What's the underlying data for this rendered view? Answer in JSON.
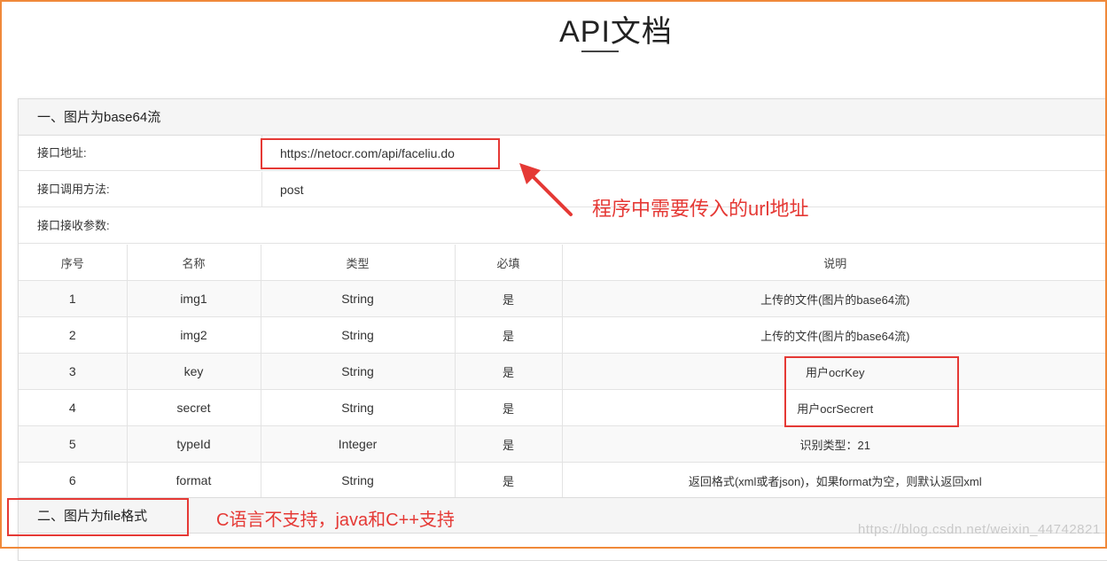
{
  "page": {
    "title": "API文档"
  },
  "section1": {
    "heading": "一、图片为base64流",
    "rows": [
      {
        "label": "接口地址:",
        "value": "https://netocr.com/api/faceliu.do"
      },
      {
        "label": "接口调用方法:",
        "value": "post"
      },
      {
        "label": "接口接收参数:",
        "value": ""
      }
    ],
    "table": {
      "headers": [
        "序号",
        "名称",
        "类型",
        "必填",
        "说明"
      ],
      "rows": [
        [
          "1",
          "img1",
          "String",
          "是",
          "上传的文件(图片的base64流)"
        ],
        [
          "2",
          "img2",
          "String",
          "是",
          "上传的文件(图片的base64流)"
        ],
        [
          "3",
          "key",
          "String",
          "是",
          "用户ocrKey"
        ],
        [
          "4",
          "secret",
          "String",
          "是",
          "用户ocrSecrert"
        ],
        [
          "5",
          "typeId",
          "Integer",
          "是",
          "识别类型：21"
        ],
        [
          "6",
          "format",
          "String",
          "是",
          "返回格式(xml或者json)，如果format为空，则默认返回xml"
        ]
      ]
    }
  },
  "section2": {
    "heading": "二、图片为file格式"
  },
  "annotations": {
    "url_note": "程序中需要传入的url地址",
    "lang_note": "C语言不支持，java和C++支持"
  },
  "watermark": "https://blog.csdn.net/weixin_44742821",
  "colors": {
    "frame": "#f0893a",
    "annotation": "#e53935"
  }
}
